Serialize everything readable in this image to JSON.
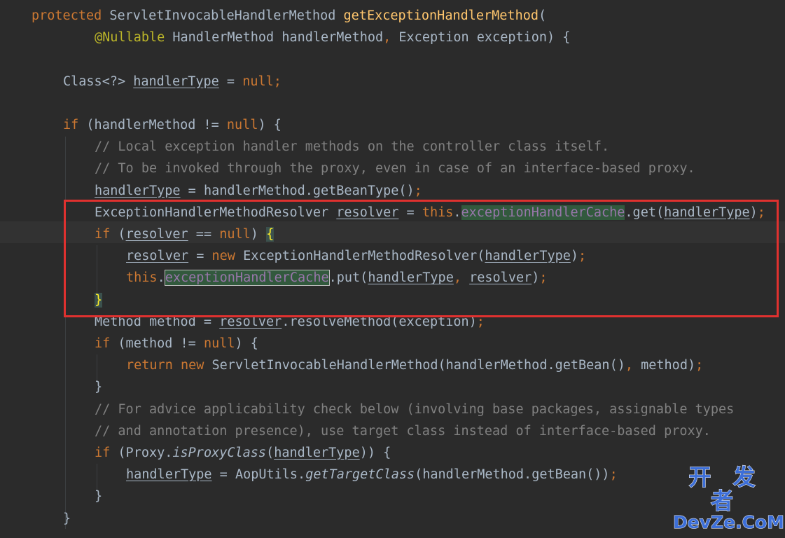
{
  "editor": {
    "lines": [
      [
        {
          "t": "protected ",
          "c": "kw"
        },
        {
          "t": "ServletInvocableHandlerMethod "
        },
        {
          "t": "getExceptionHandlerMethod",
          "c": "fn"
        },
        {
          "t": "("
        }
      ],
      [
        {
          "t": "@Nullable ",
          "c": "ann"
        },
        {
          "t": "HandlerMethod handlerMethod"
        },
        {
          "t": ", ",
          "c": "kw"
        },
        {
          "t": "Exception exception) {"
        }
      ],
      [],
      [
        {
          "t": "Class<?> "
        },
        {
          "t": "handlerType",
          "c": "u"
        },
        {
          "t": " = "
        },
        {
          "t": "null;",
          "c": "kw"
        }
      ],
      [],
      [
        {
          "t": "if ",
          "c": "kw"
        },
        {
          "t": "(handlerMethod != "
        },
        {
          "t": "null",
          "c": "kw"
        },
        {
          "t": ") {"
        }
      ],
      [
        {
          "t": "// Local exception handler methods on the controller class itself.",
          "c": "cm"
        }
      ],
      [
        {
          "t": "// To be invoked through the proxy, even in case of an interface-based proxy.",
          "c": "cm"
        }
      ],
      [
        {
          "t": "handlerType",
          "c": "u"
        },
        {
          "t": " = handlerMethod.getBeanType()"
        },
        {
          "t": ";",
          "c": "kw"
        }
      ],
      [
        {
          "t": "ExceptionHandlerMethodResolver "
        },
        {
          "t": "resolver",
          "c": "u"
        },
        {
          "t": " = "
        },
        {
          "t": "this",
          "c": "kw"
        },
        {
          "t": "."
        },
        {
          "t": "exceptionHandlerCache",
          "c": "fld"
        },
        {
          "t": ".get("
        },
        {
          "t": "handlerType",
          "c": "u"
        },
        {
          "t": ")"
        },
        {
          "t": ";",
          "c": "kw"
        }
      ],
      [
        {
          "t": "if ",
          "c": "kw"
        },
        {
          "t": "("
        },
        {
          "t": "resolver",
          "c": "u"
        },
        {
          "t": " == "
        },
        {
          "t": "null",
          "c": "kw"
        },
        {
          "t": ") "
        },
        {
          "t": "{",
          "c": "brace-hl"
        }
      ],
      [
        {
          "t": "resolver",
          "c": "u"
        },
        {
          "t": " = "
        },
        {
          "t": "new ",
          "c": "kw"
        },
        {
          "t": "ExceptionHandlerMethodResolver("
        },
        {
          "t": "handlerType",
          "c": "u"
        },
        {
          "t": ")"
        },
        {
          "t": ";",
          "c": "kw"
        }
      ],
      [
        {
          "t": "this",
          "c": "kw"
        },
        {
          "t": "."
        },
        {
          "t": "exceptionHandlerCache",
          "c": "fld-box"
        },
        {
          "t": ".put("
        },
        {
          "t": "handlerType",
          "c": "u"
        },
        {
          "t": ", ",
          "c": "kw"
        },
        {
          "t": "resolver",
          "c": "u"
        },
        {
          "t": ")"
        },
        {
          "t": ";",
          "c": "kw"
        }
      ],
      [
        {
          "t": "}",
          "c": "brace-hl"
        }
      ],
      [
        {
          "t": "Method method = "
        },
        {
          "t": "resolver",
          "c": "u"
        },
        {
          "t": ".resolveMethod(exception)"
        },
        {
          "t": ";",
          "c": "kw"
        }
      ],
      [
        {
          "t": "if ",
          "c": "kw"
        },
        {
          "t": "(method != "
        },
        {
          "t": "null",
          "c": "kw"
        },
        {
          "t": ") {"
        }
      ],
      [
        {
          "t": "return new ",
          "c": "kw"
        },
        {
          "t": "ServletInvocableHandlerMethod(handlerMethod.getBean()"
        },
        {
          "t": ", ",
          "c": "kw"
        },
        {
          "t": "method)"
        },
        {
          "t": ";",
          "c": "kw"
        }
      ],
      [
        {
          "t": "}"
        }
      ],
      [
        {
          "t": "// For advice applicability check below (involving base packages, assignable types",
          "c": "cm"
        }
      ],
      [
        {
          "t": "// and annotation presence), use target class instead of interface-based proxy.",
          "c": "cm"
        }
      ],
      [
        {
          "t": "if ",
          "c": "kw"
        },
        {
          "t": "(Proxy."
        },
        {
          "t": "isProxyClass",
          "c": "it"
        },
        {
          "t": "("
        },
        {
          "t": "handlerType",
          "c": "u"
        },
        {
          "t": ")) {"
        }
      ],
      [
        {
          "t": "handlerType",
          "c": "u"
        },
        {
          "t": " = AopUtils."
        },
        {
          "t": "getTargetClass",
          "c": "it"
        },
        {
          "t": "(handlerMethod.getBean())"
        },
        {
          "t": ";",
          "c": "kw"
        }
      ],
      [
        {
          "t": "}"
        }
      ],
      [
        {
          "t": "}"
        }
      ]
    ]
  },
  "watermark": {
    "top": "开 发 者",
    "bottom": "DevZe.CoM"
  }
}
